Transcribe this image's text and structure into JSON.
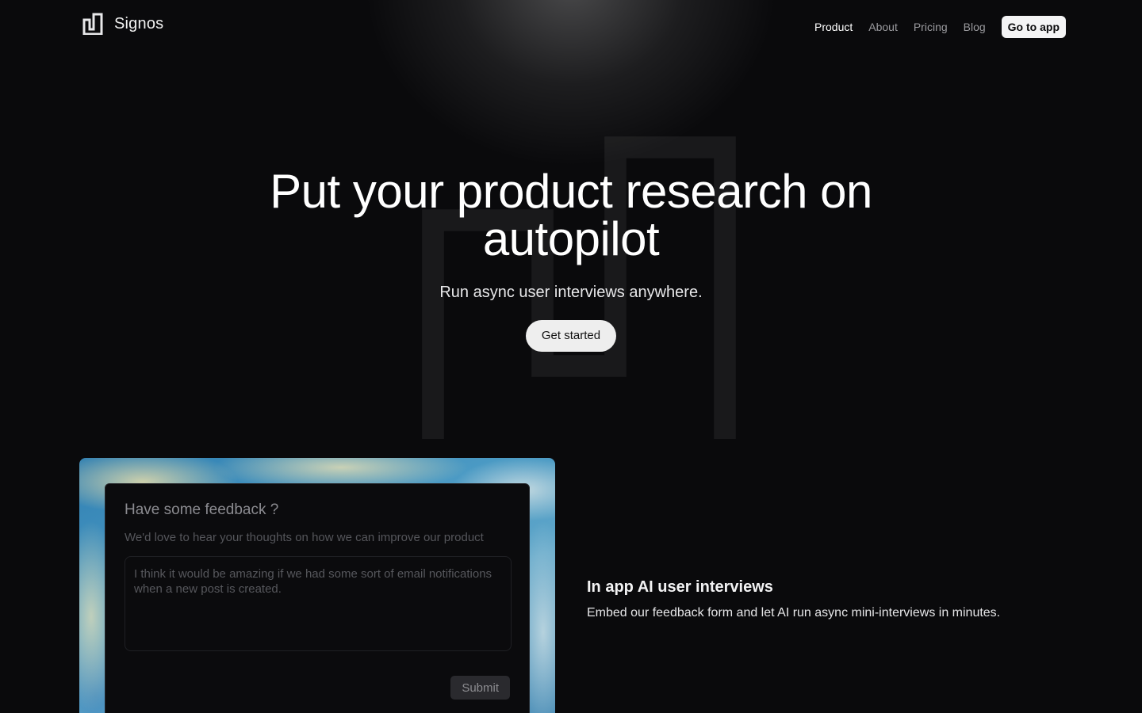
{
  "brand": {
    "name": "Signos",
    "logo_icon": "signos-logo-icon"
  },
  "nav": {
    "items": [
      {
        "label": "Product",
        "active": true
      },
      {
        "label": "About",
        "active": false
      },
      {
        "label": "Pricing",
        "active": false
      },
      {
        "label": "Blog",
        "active": false
      }
    ],
    "cta_label": "Go to app"
  },
  "hero": {
    "title": "Put your product research on autopilot",
    "subtitle": "Run async user interviews anywhere.",
    "cta_label": "Get started"
  },
  "feedback_form": {
    "title": "Have some feedback ?",
    "description": "We'd love to hear your thoughts on how we can improve our product",
    "input_placeholder": "I think it would be amazing if we had some sort of email notifications when a new post is created.",
    "submit_label": "Submit"
  },
  "feature": {
    "heading": "In app AI user interviews",
    "description": "Embed our feedback form and let AI run async mini-interviews in minutes."
  },
  "colors": {
    "background": "#0a0a0c",
    "accent_light": "#f4f4f5",
    "muted_text": "#9a9a9e"
  }
}
